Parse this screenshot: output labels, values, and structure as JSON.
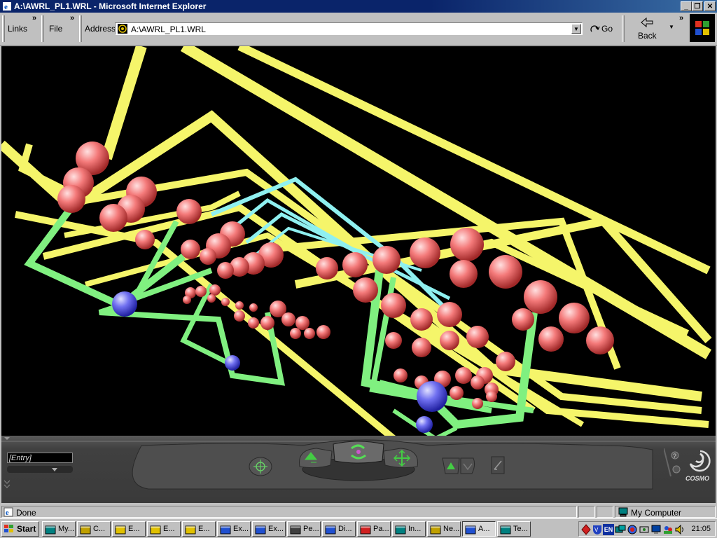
{
  "window": {
    "title": "A:\\AWRL_PL1.WRL - Microsoft Internet Explorer"
  },
  "toolbar": {
    "links_label": "Links",
    "file_label": "File",
    "address_label": "Address",
    "address_value": "A:\\AWRL_PL1.WRL",
    "go_label": "Go",
    "back_label": "Back"
  },
  "cosmo": {
    "entry_value": "[Entry]",
    "logo_text": "COSMO"
  },
  "status": {
    "text": "Done",
    "zone": "My Computer"
  },
  "taskbar": {
    "start_label": "Start",
    "tasks": [
      {
        "label": "My..."
      },
      {
        "label": "C..."
      },
      {
        "label": "E..."
      },
      {
        "label": "E..."
      },
      {
        "label": "E..."
      },
      {
        "label": "Ex..."
      },
      {
        "label": "Ex..."
      },
      {
        "label": "Pe..."
      },
      {
        "label": "Di..."
      },
      {
        "label": "Pa..."
      },
      {
        "label": "In..."
      },
      {
        "label": "Ne..."
      },
      {
        "label": "A..."
      },
      {
        "label": "Te..."
      }
    ],
    "tray_lang": "EN",
    "clock": "21:05"
  }
}
